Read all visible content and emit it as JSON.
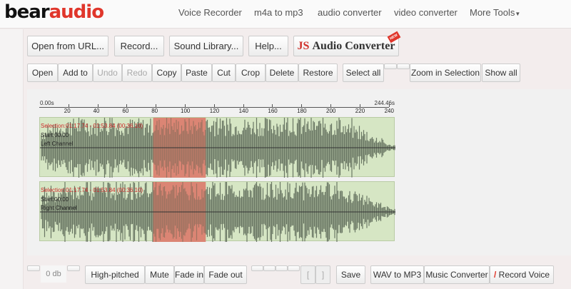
{
  "header": {
    "logo_part1": "bear",
    "logo_part2": "audio",
    "nav": [
      "Voice Recorder",
      "m4a to mp3",
      "audio converter",
      "video converter",
      "More Tools"
    ]
  },
  "toolbar1": {
    "open_url": "Open from URL...",
    "record": "Record...",
    "sound_library": "Sound Library...",
    "help": "Help...",
    "promo_js": "JS",
    "promo_text": "Audio Converter",
    "promo_badge": "NEW"
  },
  "toolbar2": {
    "open": "Open",
    "add_to": "Add to",
    "undo": "Undo",
    "redo": "Redo",
    "copy": "Copy",
    "paste": "Paste",
    "cut": "Cut",
    "crop": "Crop",
    "delete": "Delete",
    "restore": "Restore",
    "select_all": "Select all",
    "zoom_selection": "Zoom in Selection",
    "show_all": "Show all"
  },
  "timeline": {
    "start": "0.00s",
    "end": "244.46s",
    "ticks": [
      "20",
      "40",
      "60",
      "80",
      "100",
      "120",
      "140",
      "160",
      "180",
      "200",
      "220",
      "240"
    ],
    "duration_s": 244.46,
    "selection_start_s": 77.74,
    "selection_end_s": 113.84
  },
  "tracks": [
    {
      "selection": "Selection:01:17.74 - 01:53.84 (00:36.10)",
      "start": "Start:00:00",
      "name": "Left Channel"
    },
    {
      "selection": "Selection:01:17.74 - 01:53.84 (00:36.10)",
      "start": "Start:00:00",
      "name": "Right Channel"
    }
  ],
  "bottom": {
    "volume": "0 db",
    "high_pitched": "High-pitched",
    "mute": "Mute",
    "fade_in": "Fade in",
    "fade_out": "Fade out",
    "bracket_open": "[",
    "bracket_close": "]",
    "save": "Save",
    "wav_mp3": "WAV to MP3",
    "music_converter": "Music Converter",
    "record_voice": "Record Voice"
  },
  "colors": {
    "accent": "#e0362b",
    "wave": "#5f6b5a",
    "wave_bg": "#d6e6c4",
    "selection": "#d88f80"
  }
}
